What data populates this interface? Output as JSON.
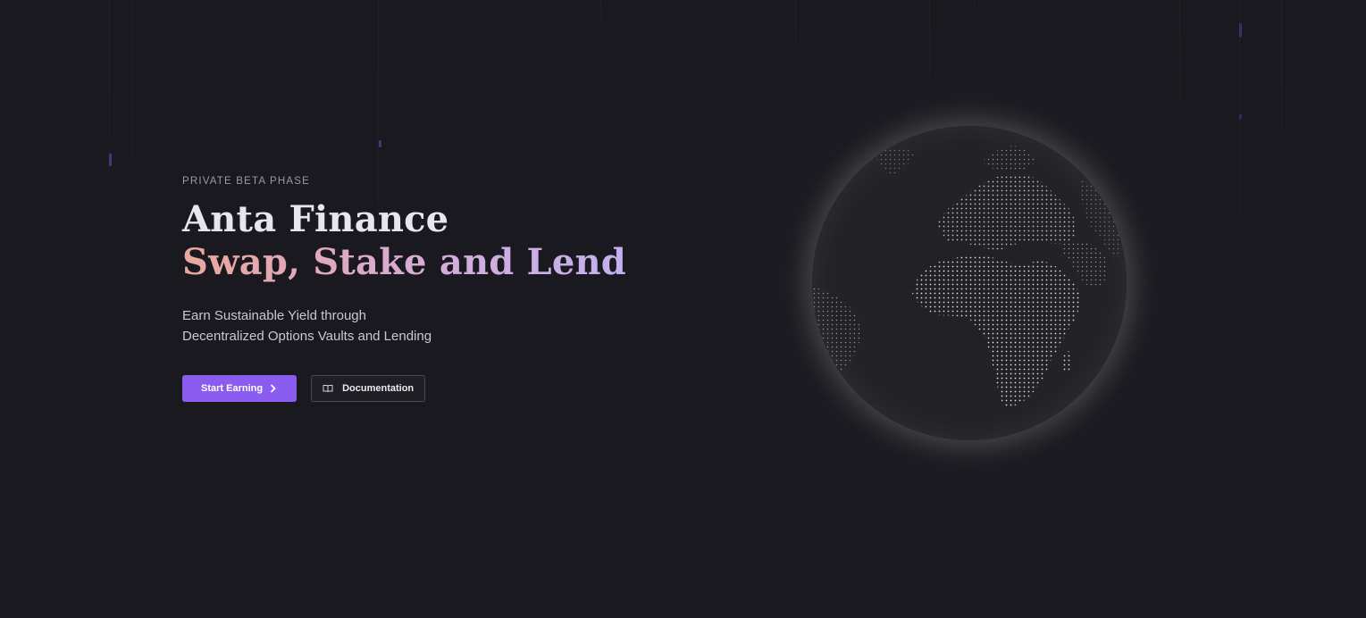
{
  "hero": {
    "eyebrow": "PRIVATE BETA PHASE",
    "title_line1": "Anta Finance",
    "title_line2": "Swap, Stake and Lend",
    "subtitle_line1": "Earn Sustainable Yield through",
    "subtitle_line2": "Decentralized Options Vaults and Lending"
  },
  "actions": {
    "primary_label": "Start Earning",
    "primary_icon": "chevron-right-icon",
    "secondary_label": "Documentation",
    "secondary_icon": "book-icon"
  },
  "colors": {
    "background": "#1a191f",
    "accent": "#8b5cf0",
    "title": "#e6e7ee",
    "gradient_start": "#e9a89a",
    "gradient_end": "#c4b0ee"
  },
  "globe": {
    "icon": "dotted-globe"
  }
}
